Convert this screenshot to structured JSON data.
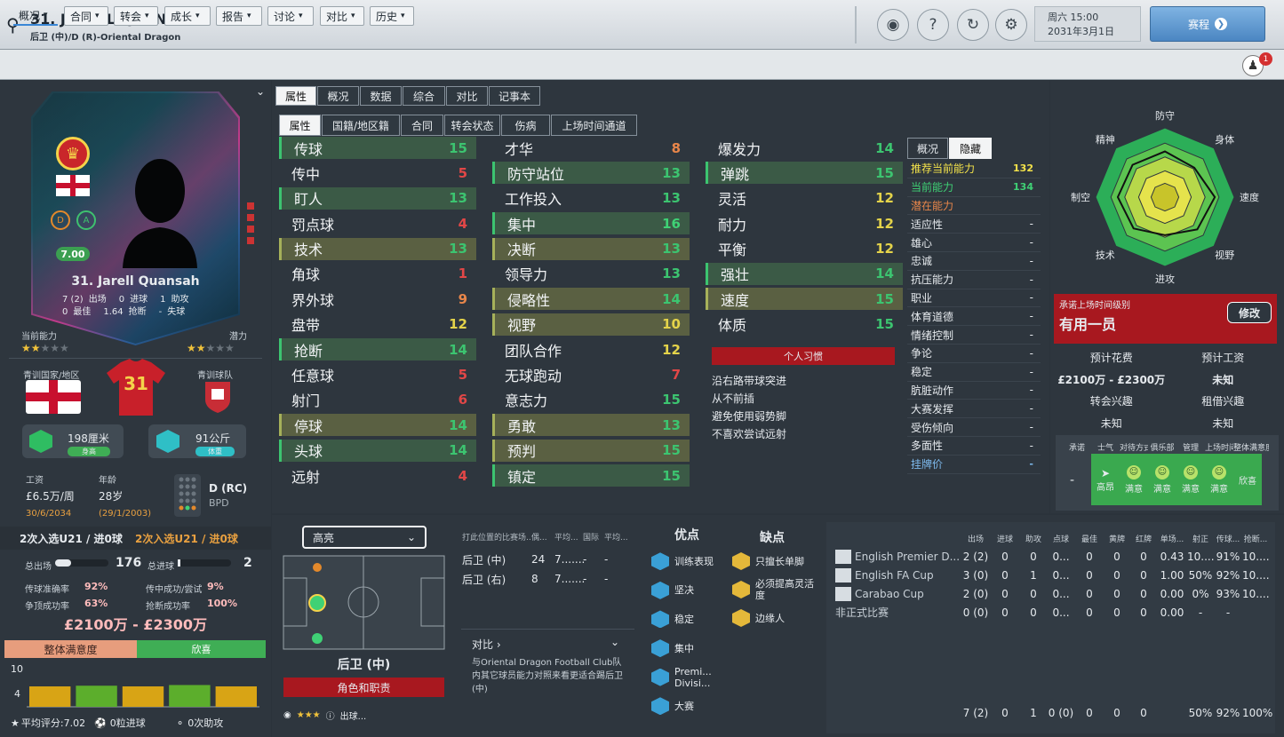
{
  "header": {
    "name": "31. JARELL QUANSAH",
    "sub": "后卫 (中)/D (R)-Oriental Dragon",
    "date1": "周六 15:00",
    "date2": "2031年3月1日",
    "next": "赛程"
  },
  "menus": [
    "概况",
    "合同",
    "转会",
    "成长",
    "报告",
    "讨论",
    "对比",
    "历史"
  ],
  "badge": "1",
  "card": {
    "name": "31. Jarell Quansah",
    "rating": "7.00",
    "apps": "7 (2)",
    "apps_l": "出场",
    "goals": "0",
    "goals_l": "进球",
    "assists": "1",
    "assists_l": "助攻",
    "best": "0",
    "best_l": "最佳",
    "tackles": "1.64",
    "tackles_l": "抢断",
    "conceded": "-",
    "conceded_l": "失球",
    "pos1": "D",
    "pos2": "A",
    "ca_label": "当前能力",
    "pa_label": "潜力"
  },
  "youth": {
    "nation_l": "青训国家/地区",
    "team_l": "青训球队",
    "shirt": "31"
  },
  "physical": {
    "height": "198厘米",
    "height_tag": "身高",
    "weight": "91公斤",
    "weight_tag": "体重"
  },
  "contract": {
    "wage_l": "工资",
    "wage": "£6.5万/周",
    "expiry": "30/6/2034",
    "age_l": "年龄",
    "age": "28岁",
    "dob": "(29/1/2003)",
    "position": "D (RC)",
    "role": "BPD"
  },
  "intl": {
    "a": "2次入选U21 / 进0球",
    "b": "2次入选U21 / 进0球"
  },
  "season": {
    "apps_l": "总出场",
    "apps": "176",
    "goals_l": "总进球",
    "goals": "2",
    "pass_l": "传球准确率",
    "pass": "92%",
    "cross_l": "传中成功/尝试",
    "cross": "9%",
    "header_l": "争顶成功率",
    "header": "63%",
    "tackle_l": "抢断成功率",
    "tackle": "100%",
    "value": "£2100万 - £2300万",
    "sat_l": "整体满意度",
    "sat_v": "欣喜",
    "progress": 0.45
  },
  "bottom": {
    "avg": "平均评分:7.02",
    "goals": "0粒进球",
    "assists": "0次助攻",
    "y_max": "10",
    "y_min": "4"
  },
  "tabs1": [
    "属性",
    "概况",
    "数据",
    "综合",
    "对比",
    "记事本"
  ],
  "tabs2": [
    "属性",
    "国籍/地区籍",
    "合同",
    "转会状态",
    "伤病",
    "上场时间通道"
  ],
  "col1": [
    [
      "传球",
      "15",
      "g1"
    ],
    [
      "传中",
      "5",
      ""
    ],
    [
      "盯人",
      "13",
      "g1"
    ],
    [
      "罚点球",
      "4",
      ""
    ],
    [
      "技术",
      "13",
      "g2"
    ],
    [
      "角球",
      "1",
      ""
    ],
    [
      "界外球",
      "9",
      ""
    ],
    [
      "盘带",
      "12",
      ""
    ],
    [
      "抢断",
      "14",
      "g1"
    ],
    [
      "任意球",
      "5",
      ""
    ],
    [
      "射门",
      "6",
      ""
    ],
    [
      "停球",
      "14",
      "g2"
    ],
    [
      "头球",
      "14",
      "g1"
    ],
    [
      "远射",
      "4",
      ""
    ]
  ],
  "col2": [
    [
      "才华",
      "8",
      ""
    ],
    [
      "防守站位",
      "13",
      "g1"
    ],
    [
      "工作投入",
      "13",
      ""
    ],
    [
      "集中",
      "16",
      "g1"
    ],
    [
      "决断",
      "13",
      "g2"
    ],
    [
      "领导力",
      "13",
      ""
    ],
    [
      "侵略性",
      "14",
      "g2"
    ],
    [
      "视野",
      "10",
      "g2"
    ],
    [
      "团队合作",
      "12",
      ""
    ],
    [
      "无球跑动",
      "7",
      ""
    ],
    [
      "意志力",
      "15",
      ""
    ],
    [
      "勇敢",
      "13",
      "g2"
    ],
    [
      "预判",
      "15",
      "g2"
    ],
    [
      "镇定",
      "15",
      "g1"
    ]
  ],
  "col3": [
    [
      "爆发力",
      "14",
      ""
    ],
    [
      "弹跳",
      "15",
      "g1"
    ],
    [
      "灵活",
      "12",
      ""
    ],
    [
      "耐力",
      "12",
      ""
    ],
    [
      "平衡",
      "12",
      ""
    ],
    [
      "强壮",
      "14",
      "g1"
    ],
    [
      "速度",
      "15",
      "g2"
    ],
    [
      "体质",
      "15",
      ""
    ]
  ],
  "traits": {
    "title": "个人习惯",
    "items": [
      "沿右路带球突进",
      "从不前插",
      "避免使用弱势脚",
      "不喜欢尝试远射"
    ]
  },
  "hidden": {
    "tab_a": "概况",
    "tab_b": "隐藏",
    "rows": [
      [
        "推荐当前能力",
        "132",
        "yellow"
      ],
      [
        "当前能力",
        "134",
        "green"
      ],
      [
        "潜在能力",
        "",
        "orange"
      ],
      [
        "适应性",
        "-",
        ""
      ],
      [
        "雄心",
        "-",
        ""
      ],
      [
        "忠诚",
        "-",
        ""
      ],
      [
        "抗压能力",
        "-",
        ""
      ],
      [
        "职业",
        "-",
        ""
      ],
      [
        "体育道德",
        "-",
        ""
      ],
      [
        "情绪控制",
        "-",
        ""
      ],
      [
        "争论",
        "-",
        ""
      ],
      [
        "稳定",
        "-",
        ""
      ],
      [
        "肮脏动作",
        "-",
        ""
      ],
      [
        "大赛发挥",
        "-",
        ""
      ],
      [
        "受伤倾向",
        "-",
        ""
      ],
      [
        "多面性",
        "-",
        ""
      ],
      [
        "挂牌价",
        "-",
        "blue"
      ]
    ]
  },
  "radar": {
    "labels": [
      "防守",
      "身体",
      "速度",
      "视野",
      "进攻",
      "技术",
      "制空",
      "精神"
    ],
    "values": [
      0.66,
      0.6,
      0.72,
      0.66,
      0.55,
      0.64,
      0.68,
      0.66
    ]
  },
  "playing": {
    "label": "承诺上场时间级别",
    "value": "有用一员",
    "edit": "修改",
    "fee_l": "预计花费",
    "fee": "£2100万 - £2300万",
    "wage_l": "预计工资",
    "wage": "未知",
    "tin_l": "转会兴趣",
    "tin": "未知",
    "lin_l": "租借兴趣",
    "lin": "未知"
  },
  "happy": {
    "heads": [
      "承诺",
      "士气",
      "对待方式",
      "俱乐部",
      "管理",
      "上场时间",
      "整体满意度"
    ],
    "promise": "-",
    "morale": "高昂",
    "cells": [
      "满意",
      "满意",
      "满意",
      "满意"
    ],
    "overall": "欣喜"
  },
  "pitch": {
    "select": "高亮",
    "position": "后卫 (中)",
    "role_btn": "角色和职责",
    "dots": "出球..."
  },
  "positions": {
    "head": [
      "打此位置的比赛场...",
      "偶...",
      "平均...",
      "国际",
      "平均..."
    ],
    "rows": [
      [
        "后卫 (中)",
        "24",
        "7.......",
        "-",
        "-"
      ],
      [
        "后卫 (右)",
        "8",
        "7.......",
        "-",
        "-"
      ]
    ],
    "compare": "对比",
    "compare_text": "与Oriental Dragon Football Club队内其它球员能力对照来看更适合踢后卫 (中)"
  },
  "strengths": {
    "pros_l": "优点",
    "cons_l": "缺点",
    "pros": [
      "训练表现",
      "坚决",
      "稳定",
      "集中",
      "Premi... Divisi...",
      "大赛"
    ],
    "cons": [
      "只擅长单脚",
      "必须提高灵活度",
      "边缘人"
    ]
  },
  "comps": {
    "head": [
      "出场",
      "进球",
      "助攻",
      "点球",
      "最佳",
      "黄牌",
      "红牌",
      "单场...",
      "射正",
      "传球...",
      "抢断..."
    ],
    "rows": [
      [
        "English Premier D...",
        "2 (2)",
        "0",
        "0",
        "0...",
        "0",
        "0",
        "0",
        "0.43",
        "10....",
        "91%",
        "10...."
      ],
      [
        "English FA Cup",
        "3 (0)",
        "0",
        "1",
        "0...",
        "0",
        "0",
        "0",
        "1.00",
        "50%",
        "92%",
        "10...."
      ],
      [
        "Carabao Cup",
        "2 (0)",
        "0",
        "0",
        "0...",
        "0",
        "0",
        "0",
        "0.00",
        "0%",
        "93%",
        "10...."
      ],
      [
        "非正式比赛",
        "0 (0)",
        "0",
        "0",
        "0...",
        "0",
        "0",
        "0",
        "0.00",
        "-",
        "-",
        ""
      ]
    ],
    "total": [
      "7 (2)",
      "0",
      "1",
      "0 (0)",
      "0",
      "0",
      "0",
      "",
      "50%",
      "92%",
      "100%"
    ]
  },
  "chart_data": {
    "type": "bar",
    "categories": [
      "1",
      "2",
      "3",
      "4",
      "5"
    ],
    "values": [
      7.0,
      7.1,
      7.0,
      7.2,
      7.0
    ],
    "ylim": [
      4,
      10
    ],
    "ylabel": "",
    "title": ""
  },
  "colors": {
    "accent": "#3a87d6",
    "green": "#3fd175",
    "red": "#e24747",
    "panel": "#323b44"
  }
}
